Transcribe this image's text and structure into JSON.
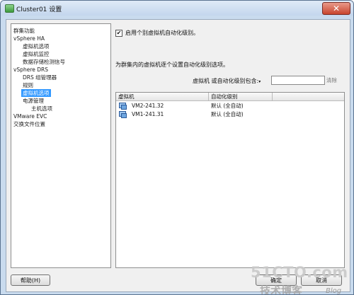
{
  "window": {
    "title": "Cluster01 设置",
    "close_glyph": "✕"
  },
  "tree": {
    "items": [
      {
        "label": "群集功能"
      },
      {
        "label": "vSphere HA"
      },
      {
        "label": "虚拟机选项"
      },
      {
        "label": "虚拟机监控"
      },
      {
        "label": "数据存储检测信号"
      },
      {
        "label": "vSphere DRS"
      },
      {
        "label": "DRS 组管理器"
      },
      {
        "label": "规则"
      },
      {
        "label": "虚拟机选项"
      },
      {
        "label": "电源管理"
      },
      {
        "label": "主机选项"
      },
      {
        "label": "VMware EVC"
      },
      {
        "label": "交换文件位置"
      }
    ],
    "selected": "虚拟机选项"
  },
  "panel": {
    "enable_checkbox_label": "启用个别虚拟机自动化级别。",
    "enable_checked": true,
    "check_glyph": "✔",
    "description": "为群集内的虚拟机逐个设置自动化级别选项。",
    "filter_label": "虚拟机 或自动化级别包含:",
    "filter_arrow": "▾",
    "search_value": "",
    "clear_label": "清除",
    "table": {
      "columns": [
        "虚拟机",
        "自动化级别"
      ],
      "rows": [
        {
          "vm": "VM2-241.32",
          "level": "默认 (全自动)",
          "icon": "vm-icon"
        },
        {
          "vm": "VM1-241.31",
          "level": "默认 (全自动)",
          "icon": "vm-icon"
        }
      ]
    }
  },
  "footer": {
    "help_label": "帮助(H)",
    "ok_label": "确定",
    "cancel_label": "取消"
  },
  "watermark": {
    "line1": "51CTO.com",
    "line2": "技术博客",
    "line3": "Blog"
  }
}
